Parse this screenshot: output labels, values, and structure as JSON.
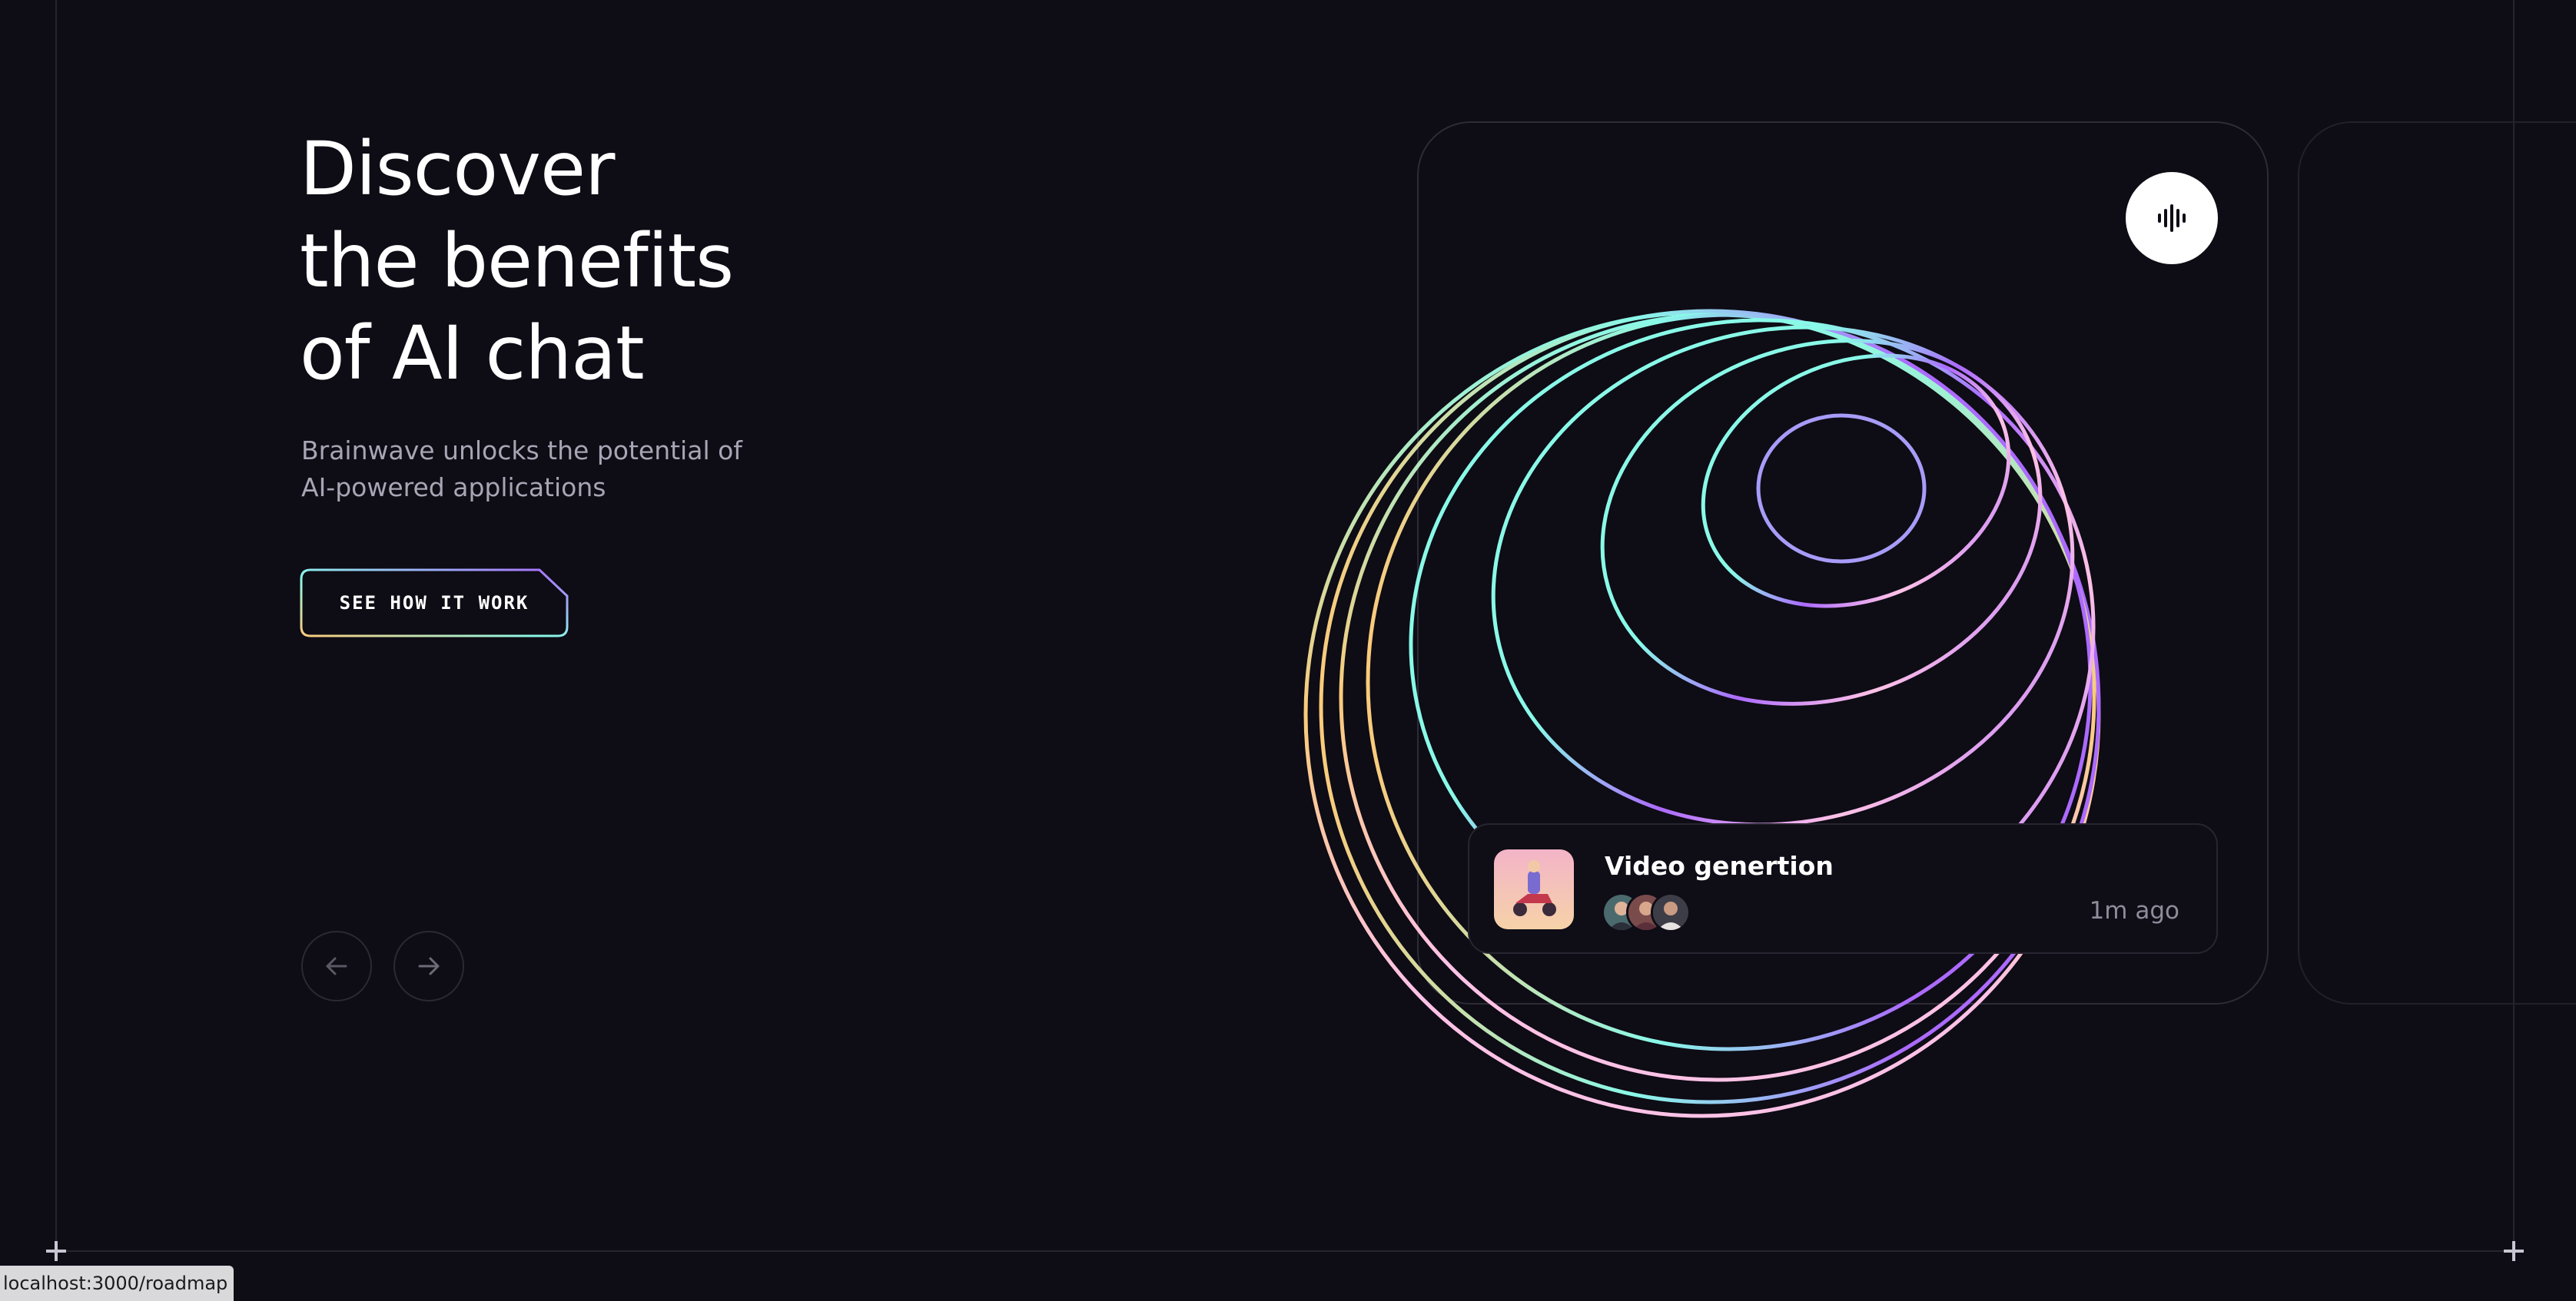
{
  "hero": {
    "title_lines": [
      "Discover",
      "the benefits",
      "of AI chat"
    ],
    "subtitle_lines": [
      "Brainwave unlocks the potential of",
      "AI-powered applications"
    ],
    "cta_label": "SEE HOW IT WORK"
  },
  "carousel_nav": {
    "prev_icon": "arrow-left-icon",
    "next_icon": "arrow-right-icon"
  },
  "card": {
    "voice_icon": "sound-wave-icon",
    "notification": {
      "title": "Video genertion",
      "time": "1m ago",
      "thumbnail_icon": "scooter-thumbnail",
      "avatar_count": 3
    }
  },
  "status_bar": {
    "url": "localhost:3000/roadmap"
  },
  "colors": {
    "background": "#0e0c15",
    "gradient_cyan": "#89f9e8",
    "gradient_yellow": "#facb7b",
    "gradient_purple": "#ac6aff",
    "gradient_pink": "#ffc2e6"
  }
}
